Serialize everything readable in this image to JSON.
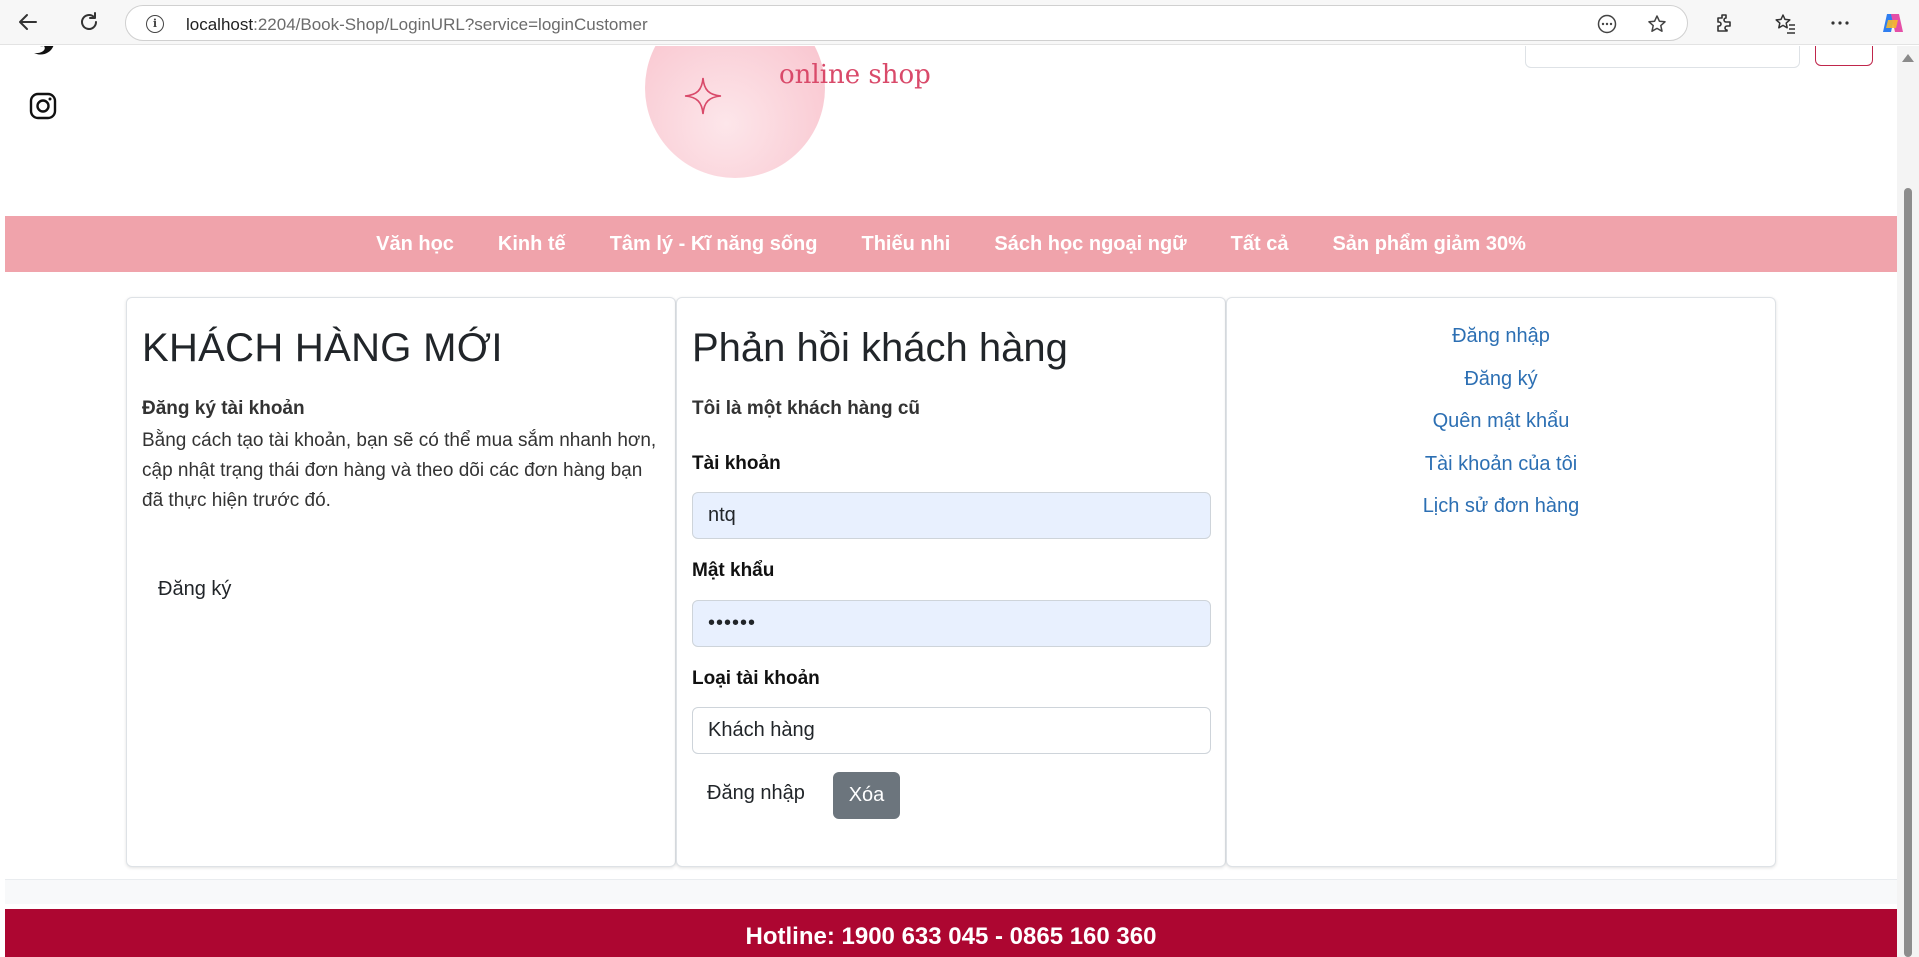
{
  "browser": {
    "url_host": "localhost",
    "url_path": ":2204/Book-Shop/LoginURL?service=loginCustomer"
  },
  "logo": {
    "tagline": "online shop"
  },
  "menu": {
    "items": [
      "Văn học",
      "Kinh tế",
      "Tâm lý - Kĩ năng sống",
      "Thiếu nhi",
      "Sách học ngoại ngữ",
      "Tất cả",
      "Sản phẩm giảm 30%"
    ]
  },
  "new_customer": {
    "title": "KHÁCH HÀNG MỚI",
    "subtitle": "Đăng ký tài khoản",
    "description": "Bằng cách tạo tài khoản, bạn sẽ có thể mua sắm nhanh hơn, cập nhật trạng thái đơn hàng và theo dõi các đơn hàng bạn đã thực hiện trước đó.",
    "register_label": "Đăng ký"
  },
  "login": {
    "title": "Phản hồi khách hàng",
    "subtitle": "Tôi là một khách hàng cũ",
    "username_label": "Tài khoản",
    "username_value": "ntq",
    "password_label": "Mật khẩu",
    "password_value": "••••••",
    "account_type_label": "Loại tài khoản",
    "account_type_value": "Khách hàng",
    "login_label": "Đăng nhập",
    "clear_label": "Xóa"
  },
  "account_links": {
    "items": [
      "Đăng nhập",
      "Đăng ký",
      "Quên mật khẩu",
      "Tài khoản của tôi",
      "Lịch sử đơn hàng"
    ]
  },
  "footer": {
    "hotline": "Hotline: 1900 633 045 - 0865 160 360"
  },
  "colors": {
    "menu_bg": "#f0a3ab",
    "footer_bg": "#ad0631",
    "link": "#2c6fb3",
    "clear_button": "#6c757d",
    "autofill_bg": "#e8f0fe"
  }
}
